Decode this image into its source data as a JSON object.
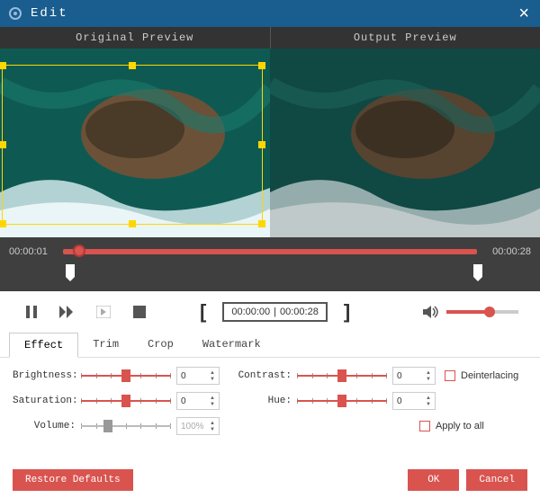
{
  "window": {
    "title": "Edit"
  },
  "preview": {
    "original_label": "Original Preview",
    "output_label": "Output Preview"
  },
  "timeline": {
    "current_time": "00:00:01",
    "end_time": "00:00:28",
    "playhead_pct": 4,
    "marker_start_pct": 2,
    "marker_end_pct": 100
  },
  "controls": {
    "range_start": "00:00:00",
    "range_end": "00:00:28",
    "volume_pct": 60
  },
  "tabs": [
    {
      "label": "Effect",
      "active": true
    },
    {
      "label": "Trim",
      "active": false
    },
    {
      "label": "Crop",
      "active": false
    },
    {
      "label": "Watermark",
      "active": false
    }
  ],
  "effect": {
    "brightness": {
      "label": "Brightness:",
      "value": "0",
      "pos": 50
    },
    "contrast": {
      "label": "Contrast:",
      "value": "0",
      "pos": 50
    },
    "saturation": {
      "label": "Saturation:",
      "value": "0",
      "pos": 50
    },
    "hue": {
      "label": "Hue:",
      "value": "0",
      "pos": 50
    },
    "volume": {
      "label": "Volume:",
      "value": "100%",
      "pos": 30
    },
    "deinterlacing_label": "Deinterlacing",
    "apply_all_label": "Apply to all"
  },
  "footer": {
    "restore": "Restore Defaults",
    "ok": "OK",
    "cancel": "Cancel"
  }
}
